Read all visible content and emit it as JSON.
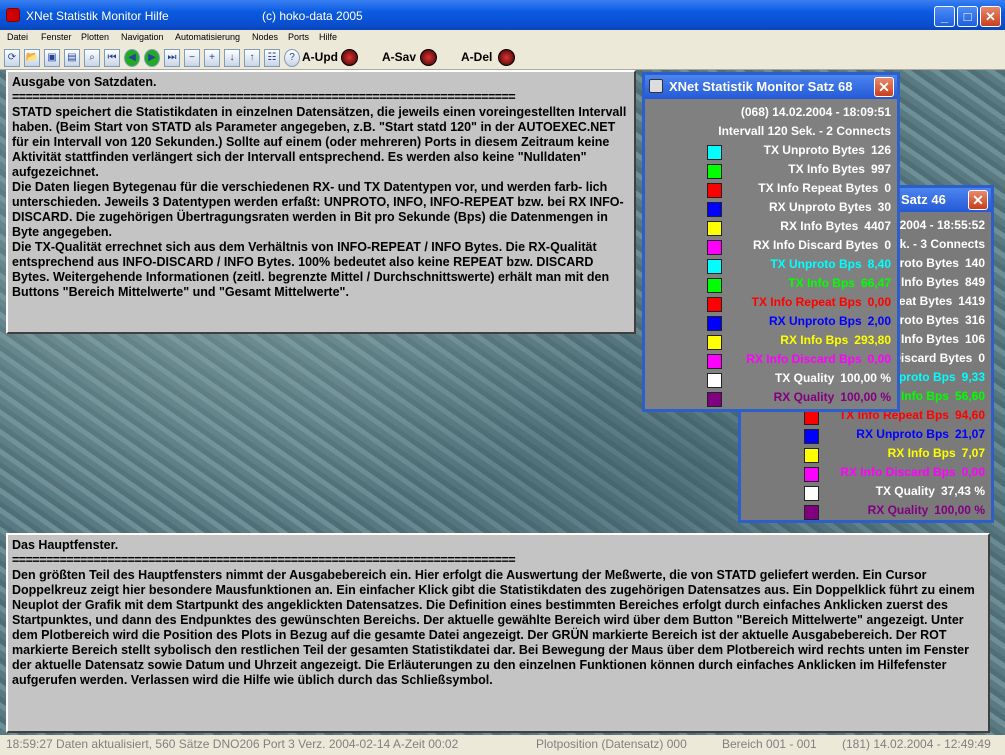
{
  "window": {
    "title": "XNet Statistik Monitor  Hilfe",
    "copyright": "(c) hoko-data 2005",
    "controls": {
      "minimize": "_",
      "maximize": "□",
      "close": "✕"
    }
  },
  "menu": [
    "Datei",
    "Fenster",
    "Plotten",
    "Navigation",
    "Automatisierung",
    "Nodes",
    "Ports",
    "Hilfe"
  ],
  "toolbar": {
    "icons": [
      "refresh-icon",
      "open-icon",
      "save-icon",
      "grid-icon",
      "zoom-page-icon",
      "first-icon",
      "prev-icon",
      "next-icon",
      "last-icon",
      "zoom-out-icon",
      "zoom-in-icon",
      "scroll-down-icon",
      "scroll-up-icon",
      "table-icon",
      "help-icon"
    ],
    "upd_label": "A-Upd",
    "sav_label": "A-Sav",
    "del_label": "A-Del"
  },
  "panel_top": {
    "heading": "Ausgabe von Satzdaten.",
    "rule": "==========================================================================",
    "body": "STATD speichert die Statistikdaten in einzelnen Datensätzen, die jeweils einen voreingestellten Intervall haben. (Beim Start von STATD als Parameter angegeben, z.B. \"Start statd 120\" in der AUTOEXEC.NET für ein Intervall von 120 Sekunden.) Sollte auf einem (oder mehreren) Ports in diesem Zeitraum keine Aktivität stattfinden verlängert sich der Intervall entsprechend. Es werden also keine \"Nulldaten\" aufgezeichnet.\nDie Daten liegen Bytegenau für die verschiedenen RX- und TX Datentypen vor, und werden farb- lich unterschieden. Jeweils 3 Datentypen werden erfaßt: UNPROTO, INFO, INFO-REPEAT bzw. bei RX INFO-DISCARD. Die zugehörigen Übertragungsraten werden in Bit pro Sekunde (Bps) die Datenmengen in Byte angegeben.\nDie TX-Qualität errechnet sich aus dem Verhältnis von INFO-REPEAT / INFO Bytes. Die RX-Qualität entsprechend aus INFO-DISCARD / INFO Bytes. 100% bedeutet also keine REPEAT bzw. DISCARD Bytes. Weitergehende Informationen (zeitl. begrenzte Mittel / Durchschnittswerte) erhält man mit den Buttons \"Bereich Mittelwerte\" und \"Gesamt Mittelwerte\"."
  },
  "panel_bottom": {
    "heading": "Das Hauptfenster.",
    "rule": "==========================================================================",
    "body": "Den größten Teil des Hauptfensters nimmt der Ausgabebereich ein. Hier erfolgt die Auswertung der Meßwerte, die von STATD geliefert werden. Ein Cursor Doppelkreuz zeigt hier besondere Mausfunktionen an. Ein einfacher Klick gibt die Statistikdaten des zugehörigen Datensatzes aus. Ein Doppelklick führt zu einem Neuplot der Grafik mit dem Startpunkt des angeklickten Datensatzes. Die Definition eines bestimmten Bereiches erfolgt durch einfaches Anklicken zuerst des Startpunktes, und dann des Endpunktes des gewünschten Bereichs. Der aktuelle gewählte Bereich wird über dem Button \"Bereich Mittelwerte\" angezeigt. Unter dem Plotbereich wird die Position des Plots in Bezug auf die gesamte Datei angezeigt. Der GRÜN markierte Bereich ist der aktuelle Ausgabebereich. Der ROT markierte Bereich stellt sybolisch den restlichen Teil der gesamten Statistikdatei dar. Bei Bewegung der Maus über dem Plotbereich wird rechts unten im Fenster der aktuelle Datensatz sowie Datum und Uhrzeit angezeigt. Die Erläuterungen zu den einzelnen Funktionen können durch einfaches Anklicken im Hilfefenster aufgerufen werden. Verlassen wird die Hilfe wie üblich durch das Schließsymbol."
  },
  "satz68": {
    "title": "XNet Statistik Monitor Satz 68",
    "close": "✕",
    "header_line": "(068)      14.02.2004 - 18:09:51",
    "interval_line": "Intervall 120 Sek. - 2 Connects",
    "rows": [
      {
        "label": "TX Unproto Bytes",
        "value": "126",
        "color": "#00ffff",
        "text_color": "#ffffff"
      },
      {
        "label": "TX Info Bytes",
        "value": "997",
        "color": "#00ff00",
        "text_color": "#ffffff"
      },
      {
        "label": "TX Info Repeat Bytes",
        "value": "0",
        "color": "#ff0000",
        "text_color": "#ffffff"
      },
      {
        "label": "RX Unproto Bytes",
        "value": "30",
        "color": "#0000ff",
        "text_color": "#ffffff"
      },
      {
        "label": "RX Info Bytes",
        "value": "4407",
        "color": "#ffff00",
        "text_color": "#ffffff"
      },
      {
        "label": "RX Info Discard Bytes",
        "value": "0",
        "color": "#ff00ff",
        "text_color": "#ffffff"
      },
      {
        "label": "TX Unproto Bps",
        "value": "8,40",
        "color": "#00ffff",
        "text_color": "#00ffff"
      },
      {
        "label": "TX Info Bps",
        "value": "66,47",
        "color": "#00ff00",
        "text_color": "#00ff00"
      },
      {
        "label": "TX Info Repeat Bps",
        "value": "0,00",
        "color": "#ff0000",
        "text_color": "#ff0000"
      },
      {
        "label": "RX Unproto Bps",
        "value": "2,00",
        "color": "#0000ff",
        "text_color": "#0000ff"
      },
      {
        "label": "RX Info Bps",
        "value": "293,80",
        "color": "#ffff00",
        "text_color": "#ffff00"
      },
      {
        "label": "RX Info Discard Bps",
        "value": "0,00",
        "color": "#ff00ff",
        "text_color": "#ff00ff"
      },
      {
        "label": "TX Quality",
        "value": "100,00 %",
        "color": "#ffffff",
        "text_color": "#ffffff"
      },
      {
        "label": "RX Quality",
        "value": "100,00 %",
        "color": "#800080",
        "text_color": "#800080"
      }
    ]
  },
  "satz46": {
    "title": "Satz 46",
    "close": "✕",
    "header_line": ".2004 - 18:55:52",
    "interval_line": "ek. - 3 Connects",
    "rows": [
      {
        "label": "Unproto Bytes",
        "value": "140",
        "color": "#00ffff",
        "text_color": "#ffffff"
      },
      {
        "label": "Info Bytes",
        "value": "849",
        "color": "#00ff00",
        "text_color": "#ffffff"
      },
      {
        "label": "peat Bytes",
        "value": "1419",
        "color": "#ff0000",
        "text_color": "#ffffff"
      },
      {
        "label": "nproto Bytes",
        "value": "316",
        "color": "#0000ff",
        "text_color": "#ffffff"
      },
      {
        "label": "Info Bytes",
        "value": "106",
        "color": "#ffff00",
        "text_color": "#ffffff"
      },
      {
        "label": "Discard Bytes",
        "value": "0",
        "color": "#ff00ff",
        "text_color": "#ffffff"
      },
      {
        "label": "nproto Bps",
        "value": "9,33",
        "color": "#00ffff",
        "text_color": "#00ffff"
      },
      {
        "label": "Info Bps",
        "value": "56,60",
        "color": "#00ff00",
        "text_color": "#00ff00"
      },
      {
        "label": "TX Info Repeat Bps",
        "value": "94,60",
        "color": "#ff0000",
        "text_color": "#ff0000"
      },
      {
        "label": "RX Unproto Bps",
        "value": "21,07",
        "color": "#0000ff",
        "text_color": "#0000ff"
      },
      {
        "label": "RX Info Bps",
        "value": "7,07",
        "color": "#ffff00",
        "text_color": "#ffff00"
      },
      {
        "label": "RX Info Discard Bps",
        "value": "0,00",
        "color": "#ff00ff",
        "text_color": "#ff00ff"
      },
      {
        "label": "TX Quality",
        "value": "37,43 %",
        "color": "#ffffff",
        "text_color": "#ffffff"
      },
      {
        "label": "RX Quality",
        "value": "100,00 %",
        "color": "#800080",
        "text_color": "#800080"
      }
    ]
  },
  "statusbar": {
    "left": "18:59:27 Daten aktualisiert, 560 Sätze DNO206 Port 3 Verz. 2004-02-14 A-Zeit 00:02",
    "plot": "Plotposition (Datensatz) 000",
    "range": "Bereich 001 - 001",
    "right": "(181) 14.02.2004 - 12:49:49"
  }
}
